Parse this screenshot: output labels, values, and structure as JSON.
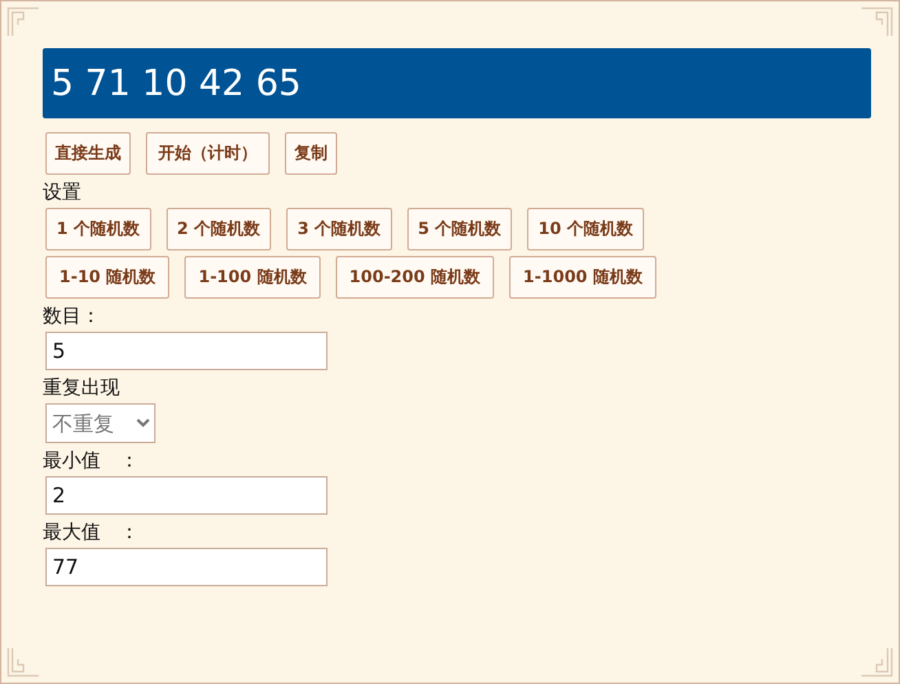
{
  "result": "5 71 10 42 65",
  "actions": [
    "直接生成",
    "开始（计时）",
    "复制"
  ],
  "settings_label": "设置",
  "count_presets": [
    "1 个随机数",
    "2 个随机数",
    "3 个随机数",
    "5 个随机数",
    "10 个随机数"
  ],
  "range_presets": [
    "1-10 随机数",
    "1-100 随机数",
    "100-200 随机数",
    "1-1000 随机数"
  ],
  "fields": [
    {
      "kind": "input",
      "label": "数目：",
      "value": "5"
    },
    {
      "kind": "select",
      "label": "重复出现",
      "value": "不重复"
    },
    {
      "kind": "input",
      "label": "最小值　：",
      "value": "2"
    },
    {
      "kind": "input",
      "label": "最大值　：",
      "value": "77"
    }
  ]
}
